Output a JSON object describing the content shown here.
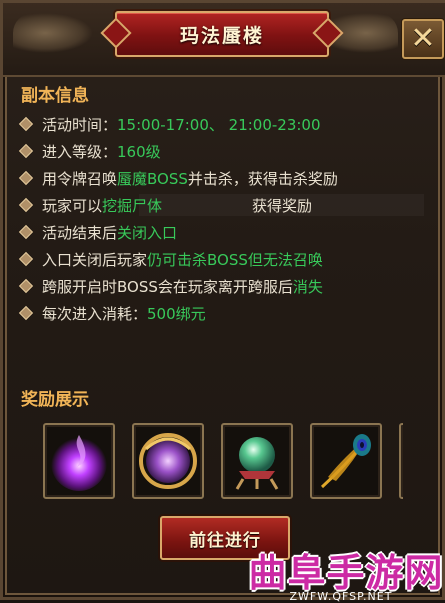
{
  "window": {
    "title": "玛法蜃楼",
    "close_label": "✕"
  },
  "info": {
    "section_title": "副本信息",
    "rows": [
      {
        "parts": [
          {
            "text": "活动时间：",
            "hl": false
          },
          {
            "text": "15:00-17:00、 21:00-23:00",
            "hl": true
          }
        ]
      },
      {
        "parts": [
          {
            "text": "进入等级：",
            "hl": false
          },
          {
            "text": "160级",
            "hl": true
          }
        ]
      },
      {
        "parts": [
          {
            "text": "用令牌召唤",
            "hl": false
          },
          {
            "text": "蜃魔BOSS",
            "hl": true
          },
          {
            "text": "并击杀，获得击杀奖励",
            "hl": false
          }
        ]
      },
      {
        "parts": [
          {
            "text": "玩家可以",
            "hl": false
          },
          {
            "text": "挖掘尸体",
            "hl": true
          },
          {
            "text": "　　　　　　获得奖励",
            "hl": false
          }
        ]
      },
      {
        "parts": [
          {
            "text": "活动结束后",
            "hl": false
          },
          {
            "text": "关闭入口",
            "hl": true
          }
        ]
      },
      {
        "parts": [
          {
            "text": "入口关闭后玩家",
            "hl": false
          },
          {
            "text": "仍可击杀BOSS但无法召唤",
            "hl": true
          }
        ]
      },
      {
        "parts": [
          {
            "text": "跨服开启时BOSS会在玩家离开跨服后",
            "hl": false
          },
          {
            "text": "消失",
            "hl": true
          }
        ]
      },
      {
        "parts": [
          {
            "text": "每次进入消耗：",
            "hl": false
          },
          {
            "text": "500绑元",
            "hl": true
          }
        ]
      }
    ]
  },
  "rewards": {
    "section_title": "奖励展示",
    "items": [
      {
        "icon": "purple-flame-orb-icon"
      },
      {
        "icon": "golden-ring-orb-icon"
      },
      {
        "icon": "crystal-ball-icon"
      },
      {
        "icon": "peacock-feather-icon"
      },
      {
        "icon": "partial-item-icon"
      }
    ]
  },
  "actions": {
    "go_label": "前往进行"
  },
  "watermark": {
    "main": "曲阜手游网",
    "sub": "ZWFW.QFSP.NET"
  },
  "colors": {
    "highlight": "#38c95a",
    "section_title": "#f1b457",
    "text": "#e9e1d0",
    "button_red": "#b12b23"
  }
}
